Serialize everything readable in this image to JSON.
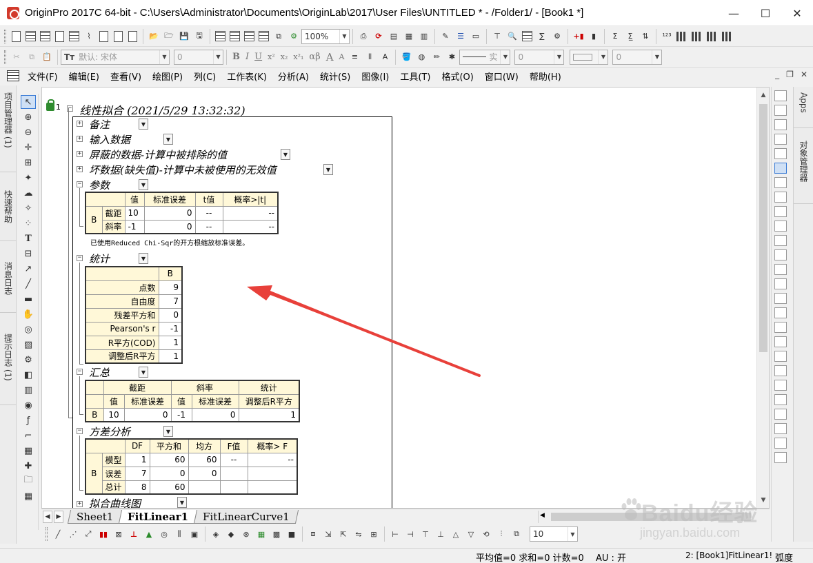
{
  "window": {
    "title": "OriginPro 2017C 64-bit - C:\\Users\\Administrator\\Documents\\OriginLab\\2017\\User Files\\UNTITLED * - /Folder1/ - [Book1 *]",
    "minimize": "—",
    "maximize": "☐",
    "close": "✕"
  },
  "toolbar1": {
    "zoom": "100%"
  },
  "toolbar2": {
    "font": "默认: 宋体",
    "font_size": "0",
    "format_buttons": [
      "B",
      "I",
      "U",
      "x²",
      "x₂",
      "x²₁",
      "αβ",
      "A",
      "A"
    ],
    "line_style": "实",
    "line_width": "0",
    "pattern_size": "0"
  },
  "menubar": {
    "items": [
      "文件(F)",
      "编辑(E)",
      "查看(V)",
      "绘图(P)",
      "列(C)",
      "工作表(K)",
      "分析(A)",
      "统计(S)",
      "图像(I)",
      "工具(T)",
      "格式(O)",
      "窗口(W)",
      "帮助(H)"
    ]
  },
  "left_tabs": [
    "项目管理器 (1)",
    "快速帮助",
    "消息日志",
    "提示日志 (1)"
  ],
  "right_tabs": [
    "Apps",
    "对象管理器"
  ],
  "report": {
    "lock_number": "1",
    "title": "线性拟合 (2021/5/29 13:32:32)",
    "nodes": {
      "notes": "备注",
      "input": "输入数据",
      "masked": "屏蔽的数据-计算中被排除的值",
      "bad": "坏数据(缺失值)-计算中未被使用的无效值",
      "params": "参数",
      "stats": "统计",
      "summary": "汇总",
      "anova": "方差分析",
      "fitcurve": "拟合曲线图"
    },
    "params_table": {
      "headers": [
        "值",
        "标准误差",
        "t值",
        "概率>|t|"
      ],
      "group": "B",
      "rows": [
        {
          "name": "截距",
          "value": "10",
          "se": "0",
          "t": "--",
          "p": "--"
        },
        {
          "name": "斜率",
          "value": "-1",
          "se": "0",
          "t": "--",
          "p": "--"
        }
      ]
    },
    "params_note": "已使用Reduced Chi-Sqr的开方根缩放标准误差。",
    "stats_table": {
      "header": "B",
      "rows": [
        {
          "name": "点数",
          "value": "9"
        },
        {
          "name": "自由度",
          "value": "7"
        },
        {
          "name": "残差平方和",
          "value": "0"
        },
        {
          "name": "Pearson's r",
          "value": "-1"
        },
        {
          "name": "R平方(COD)",
          "value": "1"
        },
        {
          "name": "调整后R平方",
          "value": "1"
        }
      ]
    },
    "summary_table": {
      "groups": [
        "截距",
        "斜率",
        "统计"
      ],
      "subheaders": [
        "值",
        "标准误差",
        "值",
        "标准误差",
        "调整后R平方"
      ],
      "row_label": "B",
      "values": [
        "10",
        "0",
        "-1",
        "0",
        "1"
      ]
    },
    "anova_table": {
      "headers": [
        "DF",
        "平方和",
        "均方",
        "F值",
        "概率> F"
      ],
      "group": "B",
      "rows": [
        {
          "name": "模型",
          "df": "1",
          "ss": "60",
          "ms": "60",
          "f": "--",
          "p": "--"
        },
        {
          "name": "误差",
          "df": "7",
          "ss": "0",
          "ms": "0",
          "f": "",
          "p": ""
        },
        {
          "name": "总计",
          "df": "8",
          "ss": "60",
          "ms": "",
          "f": "",
          "p": ""
        }
      ]
    }
  },
  "sheet_tabs": [
    "Sheet1",
    "FitLinear1",
    "FitLinearCurve1"
  ],
  "bottom_toolbar": {
    "zoom_value": "10"
  },
  "statusbar": {
    "stats": "平均值=0 求和=0 计数=0",
    "au": "AU : 开",
    "sheet": "2: [Book1]FitLinear1!",
    "angle": "弧度"
  },
  "watermark": {
    "brand": "Baidu经验",
    "url": "jingyan.baidu.com"
  },
  "colors": {
    "arrow": "#e8403a",
    "table_header_bg": "#fff8d8",
    "accent": "#3a7bd5"
  }
}
